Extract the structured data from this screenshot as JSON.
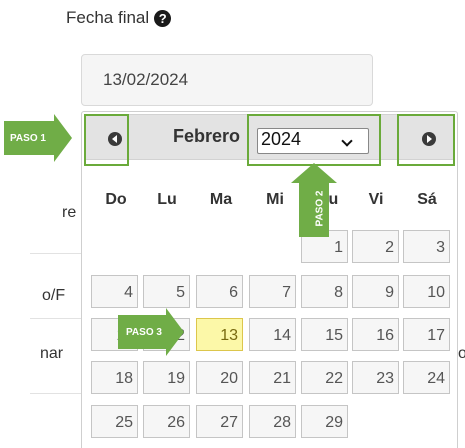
{
  "field": {
    "label": "Fecha final",
    "help_icon": "question-circle-icon",
    "value": "13/02/2024"
  },
  "background_fragments": [
    "re",
    "o/F",
    "nar",
    "o"
  ],
  "calendar": {
    "month": "Febrero",
    "year": "2024",
    "prev_icon": "chevron-left-icon",
    "next_icon": "chevron-right-icon",
    "weekdays": [
      "Do",
      "Lu",
      "Ma",
      "Mi",
      "Ju",
      "Vi",
      "Sá"
    ],
    "selected_day": "13",
    "days": [
      "1",
      "2",
      "3",
      "4",
      "5",
      "6",
      "7",
      "8",
      "9",
      "10",
      "11",
      "12",
      "13",
      "14",
      "15",
      "16",
      "17",
      "18",
      "19",
      "20",
      "21",
      "22",
      "23",
      "24",
      "25",
      "26",
      "27",
      "28",
      "29"
    ]
  },
  "annotations": {
    "step1": "PASO 1",
    "step2": "PASO 2",
    "step3": "PASO 3",
    "color": "#70ad47"
  },
  "colors": {
    "today_bg": "#fcf8a8",
    "header_bg": "#e3e3e3"
  }
}
